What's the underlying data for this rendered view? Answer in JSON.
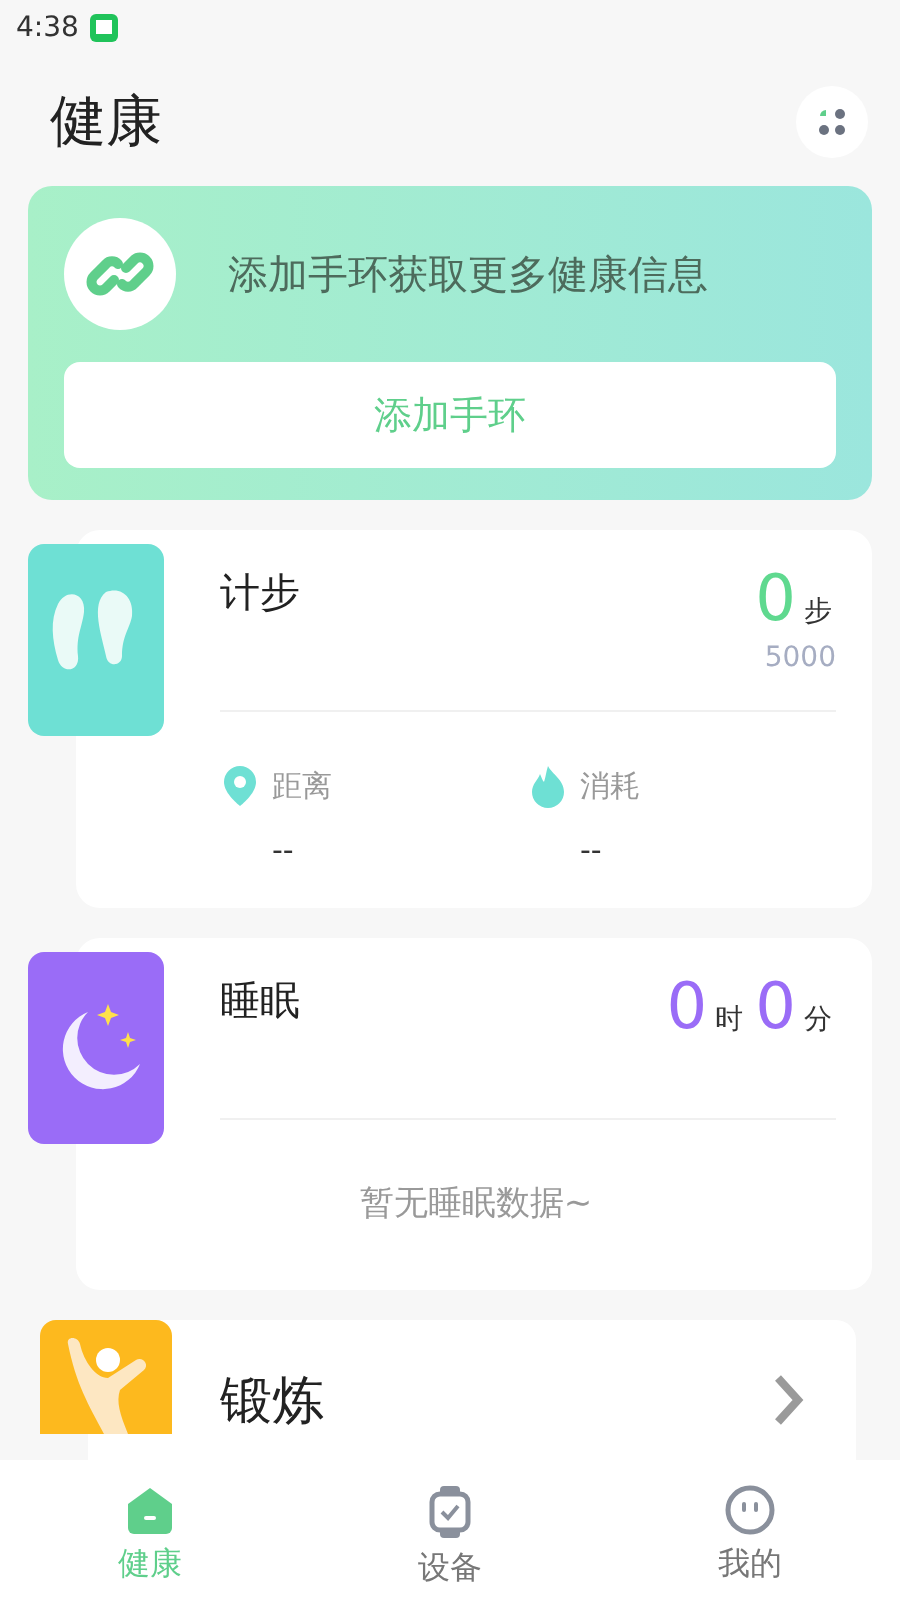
{
  "status_bar": {
    "time": "4:38"
  },
  "header": {
    "title": "健康"
  },
  "banner": {
    "message": "添加手环获取更多健康信息",
    "button": "添加手环"
  },
  "steps": {
    "title": "计步",
    "value": "0",
    "unit": "步",
    "goal": "5000",
    "stats": [
      {
        "kind": "distance",
        "label": "距离",
        "value": "--"
      },
      {
        "kind": "calories",
        "label": "消耗",
        "value": "--"
      }
    ]
  },
  "sleep": {
    "title": "睡眠",
    "hours": "0",
    "hours_unit": "时",
    "minutes": "0",
    "minutes_unit": "分",
    "empty": "暂无睡眠数据~"
  },
  "exercise": {
    "title": "锻炼"
  },
  "tabs": [
    {
      "kind": "home",
      "label": "健康",
      "selected": true
    },
    {
      "kind": "watch",
      "label": "设备",
      "selected": false
    },
    {
      "kind": "face",
      "label": "我的",
      "selected": false
    }
  ]
}
